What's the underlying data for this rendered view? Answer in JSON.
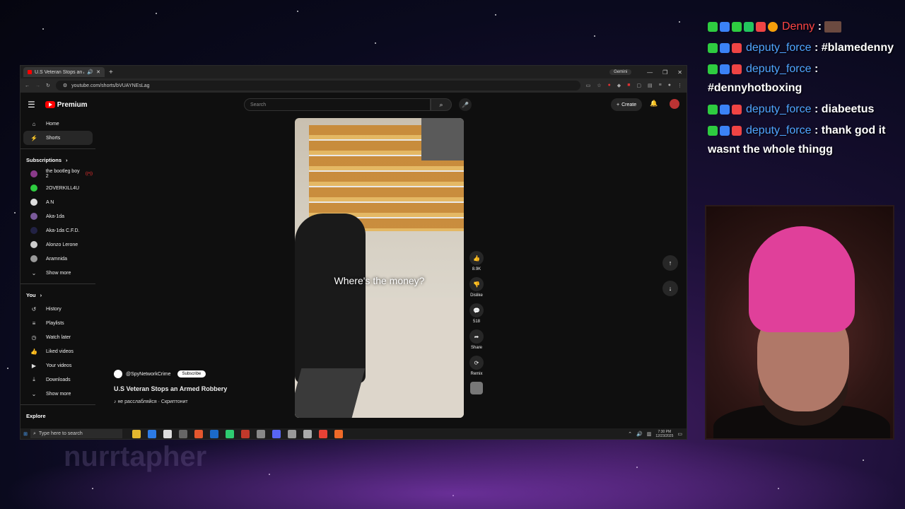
{
  "browser": {
    "tab_title": "U.S Veteran Stops an Armed ...",
    "gemini_label": "Gemini",
    "url": "youtube.com/shorts/bVUAYNEsLag"
  },
  "youtube": {
    "logo_text": "Premium",
    "search_placeholder": "Search",
    "create_label": "Create",
    "nav": [
      {
        "label": "Home",
        "icon": "home-icon"
      },
      {
        "label": "Shorts",
        "icon": "shorts-icon"
      }
    ],
    "subscriptions_header": "Subscriptions",
    "subscriptions": [
      {
        "label": "the bootleg boy 2",
        "color": "#8a3a8a"
      },
      {
        "label": "2OVERKILL4U",
        "color": "#2ecc40"
      },
      {
        "label": "A N",
        "color": "#dddddd"
      },
      {
        "label": "Aka-1da",
        "color": "#7a5a9a"
      },
      {
        "label": "Aka-1da C.F.D.",
        "color": "#222244"
      },
      {
        "label": "Alonzo Lerone",
        "color": "#cccccc"
      },
      {
        "label": "Aramnida",
        "color": "#999999"
      }
    ],
    "show_more": "Show more",
    "you_header": "You",
    "you_items": [
      {
        "label": "History",
        "icon": "history-icon"
      },
      {
        "label": "Playlists",
        "icon": "playlists-icon"
      },
      {
        "label": "Watch later",
        "icon": "clock-icon"
      },
      {
        "label": "Liked videos",
        "icon": "like-icon"
      },
      {
        "label": "Your videos",
        "icon": "video-icon"
      },
      {
        "label": "Downloads",
        "icon": "download-icon"
      }
    ],
    "show_more_2": "Show more",
    "explore_header": "Explore",
    "video": {
      "caption": "Where's the money?",
      "channel": "@SpyNetworkCrime",
      "subscribe": "Subscribe",
      "title": "U.S Veteran Stops an Armed Robbery",
      "music": "♪ не расслабляйся · Скриптонит"
    },
    "actions": {
      "likes": "8.9K",
      "dislike": "Dislike",
      "comments": "518",
      "share": "Share",
      "remix": "Remix"
    }
  },
  "taskbar": {
    "search_placeholder": "Type here to search",
    "time": "7:30 PM",
    "date": "12/23/2025"
  },
  "chat": [
    {
      "user": "Denny",
      "text": "",
      "user_color": "#ff4545",
      "emote": true
    },
    {
      "user": "deputy_force",
      "text": "#blamedenny",
      "user_color": "#4fa6ff"
    },
    {
      "user": "deputy_force",
      "text": "#dennyhotboxing",
      "user_color": "#4fa6ff"
    },
    {
      "user": "deputy_force",
      "text": "diabeetus",
      "user_color": "#4fa6ff"
    },
    {
      "user": "deputy_force",
      "text": "thank god it wasnt the whole thingg",
      "user_color": "#4fa6ff"
    }
  ],
  "background_text": "nurrtapher"
}
